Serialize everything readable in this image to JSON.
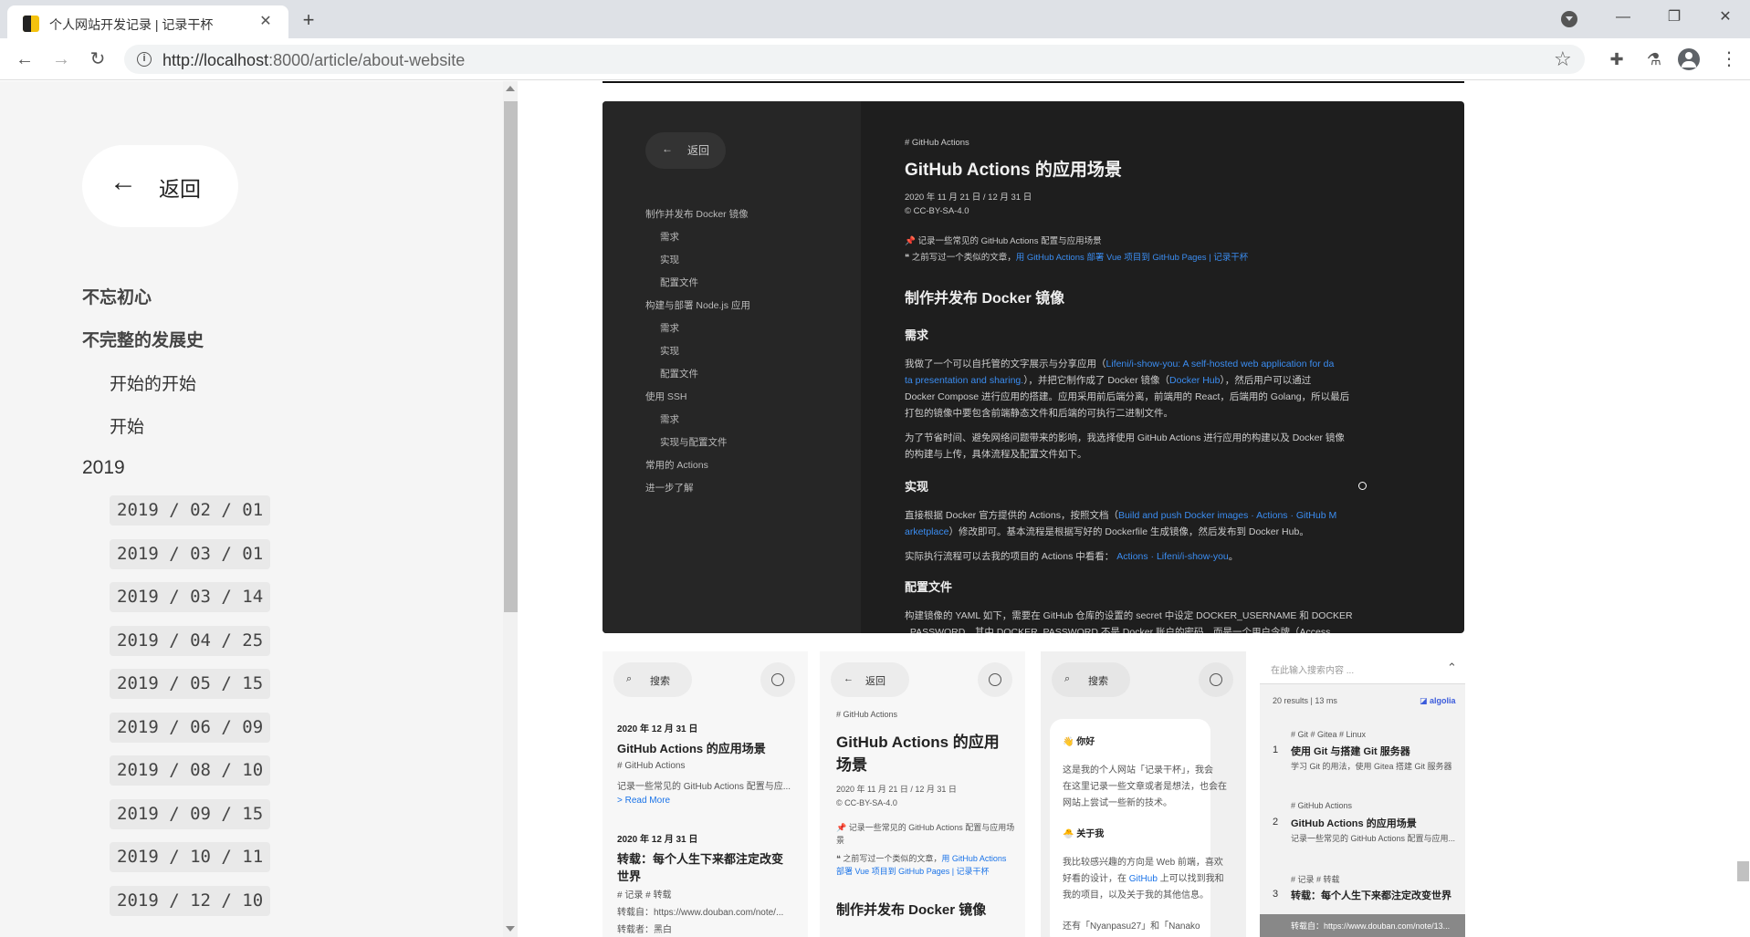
{
  "browser": {
    "tab_title": "个人网站开发记录 | 记录干杯",
    "tab_close": "✕",
    "new_tab": "+",
    "url_host": "http://localhost",
    "url_rest": ":8000/article/about-website",
    "info_glyph": "i",
    "back": "←",
    "forward": "→",
    "reload": "↻",
    "star": "☆",
    "extensions_glyph": "✚",
    "lab_glyph": "⚗",
    "menu_glyph": "⋮",
    "win_min": "—",
    "win_restore": "❐",
    "win_close": "✕"
  },
  "sidebar": {
    "back_arrow": "←",
    "back_label": "返回",
    "headings": [
      "不忘初心",
      "不完整的发展史"
    ],
    "subs": [
      "开始的开始",
      "开始"
    ],
    "year": "2019",
    "dates": [
      "2019 / 02 / 01",
      "2019 / 03 / 01",
      "2019 / 03 / 14",
      "2019 / 04 / 25",
      "2019 / 05 / 15",
      "2019 / 06 / 09",
      "2019 / 08 / 10",
      "2019 / 09 / 15",
      "2019 / 10 / 11",
      "2019 / 12 / 10"
    ]
  },
  "dark_shot": {
    "back_label": "返回",
    "toc": [
      "制作并发布 Docker 镜像",
      "需求",
      "实现",
      "配置文件",
      "构建与部署 Node.js 应用",
      "需求",
      "实现",
      "配置文件",
      "使用 SSH",
      "需求",
      "实现与配置文件",
      "常用的 Actions",
      "进一步了解"
    ],
    "tag": "# GitHub Actions",
    "title": "GitHub Actions 的应用场景",
    "dates": "2020 年 11 月 21 日  /  12 月 31 日",
    "license": "© CC-BY-SA-4.0",
    "note1": "📌 记录一些常见的 GitHub Actions 配置与应用场景",
    "note2_prefix": "❝ 之前写过一个类似的文章，",
    "note2_link": "用 GitHub Actions 部署 Vue 项目到 GitHub Pages | 记录干杯",
    "h2": "制作并发布 Docker 镜像",
    "h3_need": "需求",
    "p1_a": "我做了一个可以自托管的文字展示与分享应用（",
    "p1_link": "Lifeni/i-show-you: A self-hosted web application for da",
    "p1_b_link": "ta presentation and sharing.",
    "p1_b": "），并把它制作成了 Docker 镜像（",
    "p1_b_link2": "Docker Hub",
    "p1_b_end": "），然后用户可以通过",
    "p1_c": "Docker Compose 进行应用的搭建。应用采用前后端分离，前端用的 React，后端用的 Golang，所以最后",
    "p1_d": "打包的镜像中要包含前端静态文件和后端的可执行二进制文件。",
    "p2_a": "为了节省时间、避免网络问题带来的影响，我选择使用 GitHub Actions 进行应用的构建以及 Docker 镜像",
    "p2_b": "的构建与上传，具体流程及配置文件如下。",
    "h3_impl": "实现",
    "p3_a": "直接根据 Docker 官方提供的 Actions，按照文档（",
    "p3_link": "Build and push Docker images · Actions · GitHub M",
    "p3_b_link": "arketplace",
    "p3_b": "）修改即可。基本流程是根据写好的 Dockerfile 生成镜像，然后发布到 Docker Hub。",
    "p4": "实际执行流程可以去我的项目的 Actions 中看看：",
    "p4_link": "Actions · Lifeni/i-show-you",
    "p4_end": "。",
    "h3_config": "配置文件",
    "p5": "构建镜像的 YAML 如下，需要在 GitHub 仓库的设置的 secret 中设定 DOCKER_USERNAME 和 DOCKER",
    "p6": "_PASSWORD，其中 DOCKER_PASSWORD 不是 Docker 账户的密码，而是一个用户令牌（Access"
  },
  "mini1": {
    "search": "搜索",
    "date1": "2020 年 12 月 31 日",
    "title1": "GitHub Actions 的应用场景",
    "tag1": "# GitHub Actions",
    "desc1": "记录一些常见的 GitHub Actions 配置与应...",
    "more": "> Read More",
    "date2": "2020 年 12 月 31 日",
    "title2a": "转载：每个人生下来都注定改变",
    "title2b": "世界",
    "tag2": "# 记录  # 转载",
    "desc2": "转载自：https://www.douban.com/note/...",
    "desc3": "转载者：黑白"
  },
  "mini2": {
    "back": "返回",
    "tag": "# GitHub Actions",
    "title_a": "GitHub Actions 的应用",
    "title_b": "场景",
    "dates": "2020 年 11 月 21 日  /  12 月 31 日",
    "license": "© CC-BY-SA-4.0",
    "note1a": "📌 记录一些常见的 GitHub Actions 配置与应用场",
    "note1b": "景",
    "note2a": "❝ 之前写过一个类似的文章，",
    "note2a_link": "用 GitHub Actions",
    "note2b_link": "部署 Vue 项目到 GitHub Pages | 记录干杯",
    "h2": "制作并发布 Docker 镜像"
  },
  "mini3": {
    "search": "搜索",
    "hello": "👋 你好",
    "p1a": "这是我的个人网站「记录干杯」，我会",
    "p1b": "在这里记录一些文章或者是想法，也会在",
    "p1c": "网站上尝试一些新的技术。",
    "about": "🐣 关于我",
    "p2a": "我比较感兴趣的方向是 Web 前端，喜欢",
    "p2b": "好看的设计，在 ",
    "p2b_link": "GitHub",
    "p2b_end": " 上可以找到我和",
    "p2c": "我的项目，以及关于我的其他信息。",
    "p3": "还有「Nyanpasu27」和「Nanako"
  },
  "search_panel": {
    "placeholder": "在此输入搜索内容 ...",
    "collapse": "⌃",
    "stats": "20 results | 13 ms",
    "brand": "algolia",
    "r1_tags": "# Git  # Gitea  # Linux",
    "r1_num": "1",
    "r1_title": "使用 Git 与搭建 Git 服务器",
    "r1_desc": "学习 Git 的用法，使用 Gitea 搭建 Git 服务器",
    "r2_tags": "# GitHub Actions",
    "r2_num": "2",
    "r2_title": "GitHub Actions 的应用场景",
    "r2_desc": "记录一些常见的 GitHub Actions 配置与应用...",
    "r3_tags": "# 记录  # 转载",
    "r3_num": "3",
    "r3_title": "转载：每个人生下来都注定改变世界",
    "r3_desc": "转载自：https://www.douban.com/note/13..."
  }
}
